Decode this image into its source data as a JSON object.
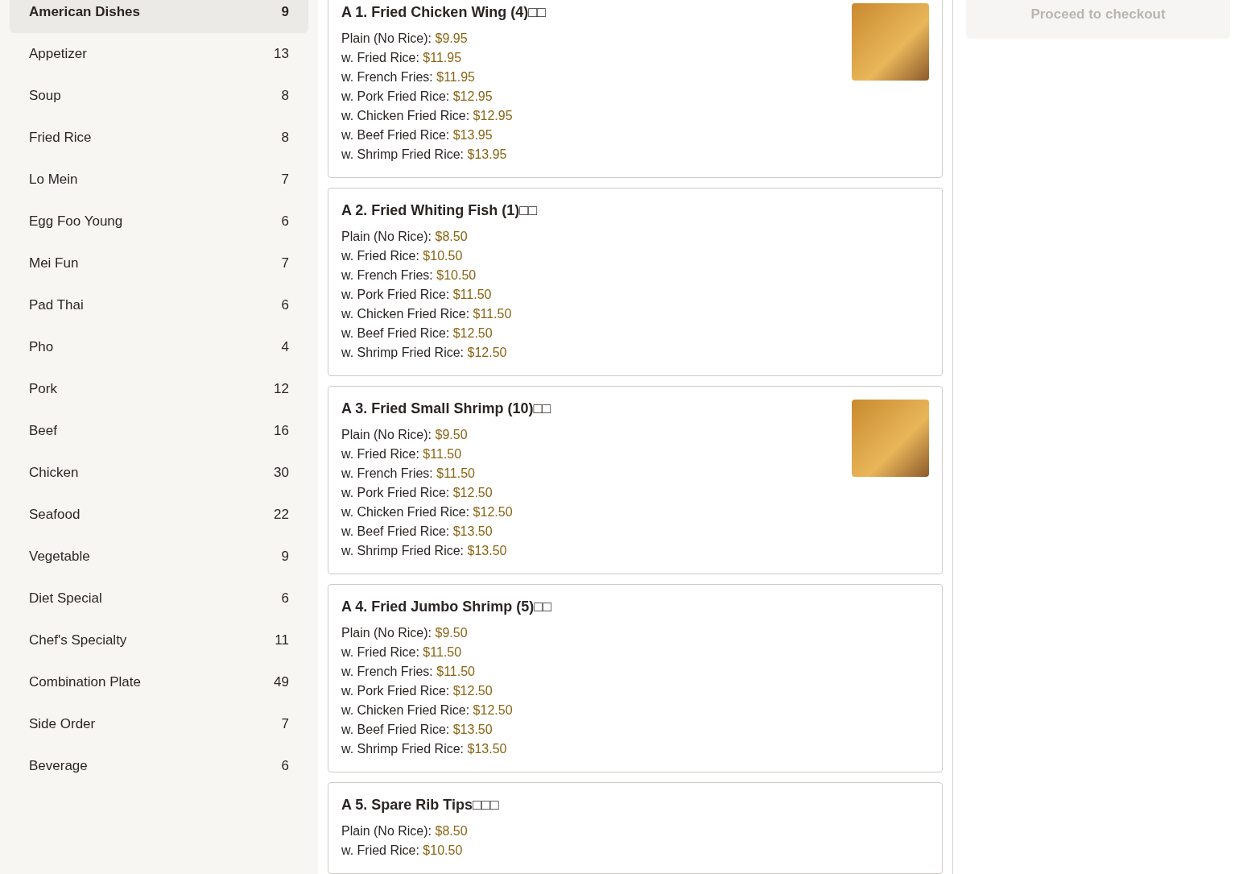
{
  "categories": [
    {
      "name": "American Dishes",
      "count": "9",
      "selected": true
    },
    {
      "name": "Appetizer",
      "count": "13",
      "selected": false
    },
    {
      "name": "Soup",
      "count": "8",
      "selected": false
    },
    {
      "name": "Fried Rice",
      "count": "8",
      "selected": false
    },
    {
      "name": "Lo Mein",
      "count": "7",
      "selected": false
    },
    {
      "name": "Egg Foo Young",
      "count": "6",
      "selected": false
    },
    {
      "name": "Mei Fun",
      "count": "7",
      "selected": false
    },
    {
      "name": "Pad Thai",
      "count": "6",
      "selected": false
    },
    {
      "name": "Pho",
      "count": "4",
      "selected": false
    },
    {
      "name": "Pork",
      "count": "12",
      "selected": false
    },
    {
      "name": "Beef",
      "count": "16",
      "selected": false
    },
    {
      "name": "Chicken",
      "count": "30",
      "selected": false
    },
    {
      "name": "Seafood",
      "count": "22",
      "selected": false
    },
    {
      "name": "Vegetable",
      "count": "9",
      "selected": false
    },
    {
      "name": "Diet Special",
      "count": "6",
      "selected": false
    },
    {
      "name": "Chef's Specialty",
      "count": "11",
      "selected": false
    },
    {
      "name": "Combination Plate",
      "count": "49",
      "selected": false
    },
    {
      "name": "Side Order",
      "count": "7",
      "selected": false
    },
    {
      "name": "Beverage",
      "count": "6",
      "selected": false
    }
  ],
  "menu_items": [
    {
      "title": "A 1. Fried Chicken Wing (4)□□",
      "photo": true,
      "options": [
        {
          "label": "Plain (No Rice):",
          "price": "$9.95"
        },
        {
          "label": "w. Fried Rice:",
          "price": "$11.95"
        },
        {
          "label": "w. French Fries:",
          "price": "$11.95"
        },
        {
          "label": "w. Pork Fried Rice:",
          "price": "$12.95"
        },
        {
          "label": "w. Chicken Fried Rice:",
          "price": "$12.95"
        },
        {
          "label": "w. Beef Fried Rice:",
          "price": "$13.95"
        },
        {
          "label": "w. Shrimp Fried Rice:",
          "price": "$13.95"
        }
      ]
    },
    {
      "title": "A 2. Fried Whiting Fish (1)□□",
      "photo": false,
      "options": [
        {
          "label": "Plain (No Rice):",
          "price": "$8.50"
        },
        {
          "label": "w. Fried Rice:",
          "price": "$10.50"
        },
        {
          "label": "w. French Fries:",
          "price": "$10.50"
        },
        {
          "label": "w. Pork Fried Rice:",
          "price": "$11.50"
        },
        {
          "label": "w. Chicken Fried Rice:",
          "price": "$11.50"
        },
        {
          "label": "w. Beef Fried Rice:",
          "price": "$12.50"
        },
        {
          "label": "w. Shrimp Fried Rice:",
          "price": "$12.50"
        }
      ]
    },
    {
      "title": "A 3. Fried Small Shrimp (10)□□",
      "photo": true,
      "options": [
        {
          "label": "Plain (No Rice):",
          "price": "$9.50"
        },
        {
          "label": "w. Fried Rice:",
          "price": "$11.50"
        },
        {
          "label": "w. French Fries:",
          "price": "$11.50"
        },
        {
          "label": "w. Pork Fried Rice:",
          "price": "$12.50"
        },
        {
          "label": "w. Chicken Fried Rice:",
          "price": "$12.50"
        },
        {
          "label": "w. Beef Fried Rice:",
          "price": "$13.50"
        },
        {
          "label": "w. Shrimp Fried Rice:",
          "price": "$13.50"
        }
      ]
    },
    {
      "title": "A 4. Fried Jumbo Shrimp (5)□□",
      "photo": false,
      "options": [
        {
          "label": "Plain (No Rice):",
          "price": "$9.50"
        },
        {
          "label": "w. Fried Rice:",
          "price": "$11.50"
        },
        {
          "label": "w. French Fries:",
          "price": "$11.50"
        },
        {
          "label": "w. Pork Fried Rice:",
          "price": "$12.50"
        },
        {
          "label": "w. Chicken Fried Rice:",
          "price": "$12.50"
        },
        {
          "label": "w. Beef Fried Rice:",
          "price": "$13.50"
        },
        {
          "label": "w. Shrimp Fried Rice:",
          "price": "$13.50"
        }
      ]
    },
    {
      "title": "A 5. Spare Rib Tips□□□",
      "photo": false,
      "options": [
        {
          "label": "Plain (No Rice):",
          "price": "$8.50"
        },
        {
          "label": "w. Fried Rice:",
          "price": "$10.50"
        }
      ]
    }
  ],
  "checkout": {
    "label": "Proceed to checkout",
    "disabled": true
  }
}
